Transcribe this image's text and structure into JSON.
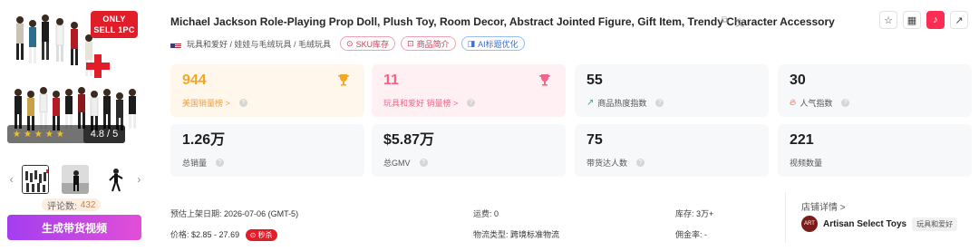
{
  "product": {
    "title": "Michael Jackson Role-Playing Prop Doll, Plush Toy, Room Decor, Abstract Jointed Figure, Gift Item, Trendy Character Accessory",
    "title_icons": [
      "copy-icon",
      "translate-icon"
    ],
    "category_path": "玩具和爱好 / 娃娃与毛绒玩具 / 毛绒玩具",
    "tags": {
      "sku": "SKU库存",
      "intro": "商品简介",
      "ai": "AI标题优化"
    }
  },
  "image": {
    "badge_line1": "ONLY",
    "badge_line2": "SELL 1PC",
    "stars": "★★★★★",
    "rating": "4.8 / 5",
    "review_label": "评论数:",
    "review_count": "432",
    "generate_button": "生成带货视频"
  },
  "header_actions": [
    "star-icon",
    "grid-icon",
    "tiktok-icon",
    "external-link-icon"
  ],
  "stats": [
    {
      "value": "944",
      "label": "美国销量榜 >",
      "style": "orange",
      "icon": "trophy-icon"
    },
    {
      "value": "11",
      "label": "玩具和爱好 销量榜 >",
      "style": "pink",
      "icon": "trophy-icon"
    },
    {
      "value": "55",
      "label": "商品热度指数",
      "style": "plain",
      "icon": "trend-icon"
    },
    {
      "value": "30",
      "label": "人气指数",
      "style": "plain",
      "icon": "fire-icon"
    },
    {
      "value": "1.26万",
      "label": "总销量",
      "style": "plain"
    },
    {
      "value": "$5.87万",
      "label": "总GMV",
      "style": "plain"
    },
    {
      "value": "75",
      "label": "带货达人数",
      "style": "plain"
    },
    {
      "value": "221",
      "label": "视频数量",
      "style": "plain"
    }
  ],
  "details": {
    "listing_date_label": "预估上架日期:",
    "listing_date_value": "2026-07-06 (GMT-5)",
    "price_label": "价格:",
    "price_value": "$2.85 - 27.69",
    "promo": "⊙ 秒杀",
    "shipping_fee_label": "运费:",
    "shipping_fee_value": "0",
    "logistics_label": "物流类型:",
    "logistics_value": "跨境标准物流",
    "stock_label": "库存:",
    "stock_value": "3万+",
    "commission_label": "佣金率:",
    "commission_value": "-"
  },
  "store": {
    "link_label": "店铺详情 >",
    "name": "Artisan Select Toys",
    "category": "玩具和爱好",
    "avatar_text": "ART"
  },
  "colors": {
    "accent_pink": "#fe2c55",
    "orange": "#f5a623",
    "pink": "#f0648a",
    "button_from": "#a33ef0",
    "button_to": "#e24fd6"
  }
}
